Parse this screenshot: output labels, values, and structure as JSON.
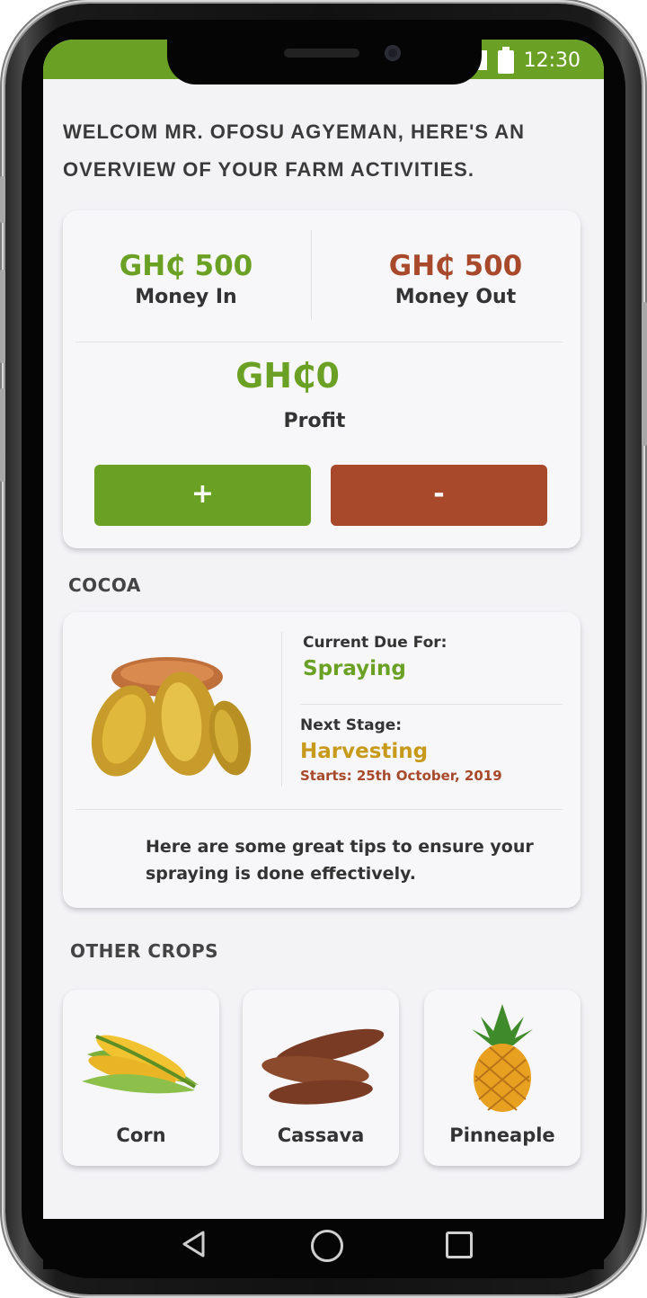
{
  "status_bar": {
    "time": "12:30"
  },
  "welcome_text": "WELCOM MR. OFOSU AGYEMAN, HERE'S AN OVERVIEW OF YOUR FARM ACTIVITIES.",
  "finance": {
    "money_in": {
      "amount": "GH₵ 500",
      "label": "Money In"
    },
    "money_out": {
      "amount": "GH₵ 500",
      "label": "Money Out"
    },
    "profit": {
      "amount": "GH₵0",
      "label": "Profit"
    },
    "add_button": "+",
    "subtract_button": "-"
  },
  "cocoa": {
    "section_title": "COCOA",
    "current_label": "Current Due For:",
    "current_value": "Spraying",
    "next_label": "Next Stage:",
    "next_value": "Harvesting",
    "starts": "Starts: 25th October, 2019",
    "tips": "Here are some great tips to ensure your spraying is done effectively."
  },
  "other_crops": {
    "section_title": "OTHER CROPS",
    "items": [
      {
        "name": "Corn"
      },
      {
        "name": "Cassava"
      },
      {
        "name": "Pinneaple"
      }
    ]
  },
  "colors": {
    "brand_green": "#6aa125",
    "expense_brown": "#a7492a",
    "next_stage_gold": "#c79a1c"
  }
}
